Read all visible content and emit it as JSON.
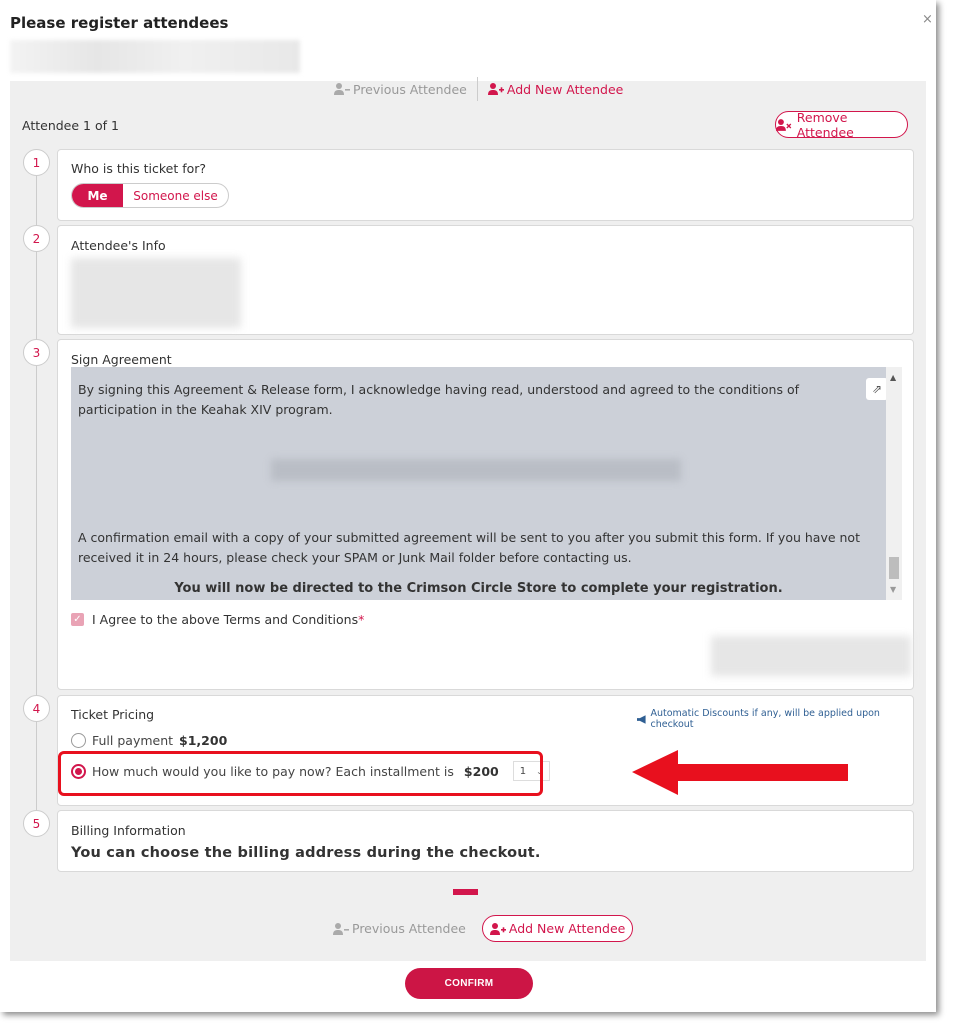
{
  "dialog": {
    "title": "Please register attendees",
    "close_symbol": "×"
  },
  "nav": {
    "previous_label": "Previous Attendee",
    "add_label": "Add New Attendee"
  },
  "attendee": {
    "count_label": "Attendee 1 of 1",
    "remove_label": "Remove Attendee"
  },
  "steps": [
    {
      "number": "1",
      "title": "Who is this ticket for?"
    },
    {
      "number": "2",
      "title": "Attendee's Info"
    },
    {
      "number": "3",
      "title": "Sign Agreement"
    },
    {
      "number": "4",
      "title": "Ticket Pricing"
    },
    {
      "number": "5",
      "title": "Billing Information"
    }
  ],
  "who": {
    "options": [
      "Me",
      "Someone else"
    ],
    "selected": "Me"
  },
  "agreement": {
    "para1": "By signing this Agreement & Release form, I acknowledge having read, understood and agreed to the conditions of participation in the Keahak XIV program.",
    "para2": "A confirmation email with a copy of your submitted agreement will be sent to you after you submit this form. If you have not received it in 24 hours, please check your SPAM or Junk Mail folder before contacting us.",
    "bold_line": "You will now be directed to the Crimson Circle Store to complete your registration.",
    "agree_label": "I Agree to the above Terms and Conditions",
    "required_mark": "*",
    "agree_checked": true
  },
  "pricing": {
    "discount_note": "Automatic Discounts if any, will be applied upon checkout",
    "full_label": "Full payment",
    "full_price": "$1,200",
    "installment_label": "How much would you like to pay now? Each installment is",
    "installment_price": "$200",
    "installment_count": "1",
    "selected": "installment"
  },
  "billing": {
    "note": "You can choose the billing address during the checkout."
  },
  "confirm_label": "CONFIRM",
  "colors": {
    "accent": "#d2164c",
    "annotation": "#e8101e"
  }
}
